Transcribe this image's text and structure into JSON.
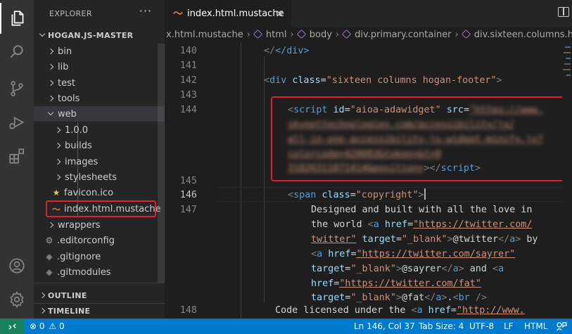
{
  "sidebar": {
    "title": "EXPLORER",
    "more": "···",
    "root": "HOGAN.JS-MASTER",
    "items": [
      {
        "label": "bin"
      },
      {
        "label": "lib"
      },
      {
        "label": "test"
      },
      {
        "label": "tools"
      },
      {
        "label": "web"
      },
      {
        "label": "1.0.0"
      },
      {
        "label": "builds"
      },
      {
        "label": "images"
      },
      {
        "label": "stylesheets"
      },
      {
        "label": "favicon.ico"
      },
      {
        "label": "index.html.mustache"
      },
      {
        "label": "wrappers"
      },
      {
        "label": ".editorconfig"
      },
      {
        "label": ".gitignore"
      },
      {
        "label": ".gitmodules"
      }
    ],
    "outline": "OUTLINE",
    "timeline": "TIMELINE"
  },
  "tab": {
    "label": "index.html.mustache",
    "close": "×"
  },
  "breadcrumb": {
    "file": "x.html.mustache",
    "items": [
      "html",
      "body",
      "div.primary.container",
      "div.sixteen.columns.hogan-f"
    ]
  },
  "editor": {
    "line_numbers": [
      "140",
      "141",
      "142",
      "143",
      "144",
      "145",
      "146",
      "147",
      "148"
    ],
    "code": {
      "l140_close": "</div>",
      "l142_tag": "div",
      "l142_attr": "class",
      "l142_val": "\"sixteen columns hogan-footer\"",
      "l144_tag": "script",
      "l144_attr1": "id",
      "l144_val1": "\"aioa-adawidget\"",
      "l144_attr2": "src",
      "l144_blur1": "\"https://www.",
      "l144_blur2": "skynettechnologies.com/accessibility/js/",
      "l144_blur3": "all-in-one-accessibility-js-widget-minify.js?",
      "l144_blur4": "colorcode=420083&token=&t=0",
      "l144_blur5": "31826311871414&position=",
      "l144_end": "script",
      "l146_tag": "span",
      "l146_attr": "class",
      "l146_val": "\"copyright\"",
      "l147_text1": "Designed and built with all the love in",
      "l147_text2": "the world ",
      "l147_href": "href",
      "l147_url1": "\"https://twitter.com/",
      "l147_url1b": "twitter\"",
      "l147_target": "target",
      "l147_blank": "\"_blank\"",
      "l147_twitter": "@twitter",
      "l147_by": " by",
      "l147_url2": "\"https://twitter.com/sayrer\"",
      "l147_sayrer": "@sayrer",
      "l147_and": " and ",
      "l147_url3": "\"https://twitter.com/fat\"",
      "l147_fat": "@fat",
      "l147_dot": ".",
      "l148_text": "Code licensed under the ",
      "l148_url": "\"http://www."
    }
  },
  "statusbar": {
    "errors": "0",
    "warnings": "0",
    "position": "Ln 146, Col 37",
    "tabsize": "Tab Size: 4",
    "encoding": "UTF-8",
    "eol": "LF",
    "language": "HTML"
  },
  "colors": {
    "activity_bar": "#333333",
    "sidebar": "#252526",
    "editor": "#1e1e1e",
    "statusbar": "#007acc",
    "highlight_red": "#e0202a",
    "tag": "#569cd6",
    "attr": "#9cdcfe",
    "string": "#ce9178"
  }
}
